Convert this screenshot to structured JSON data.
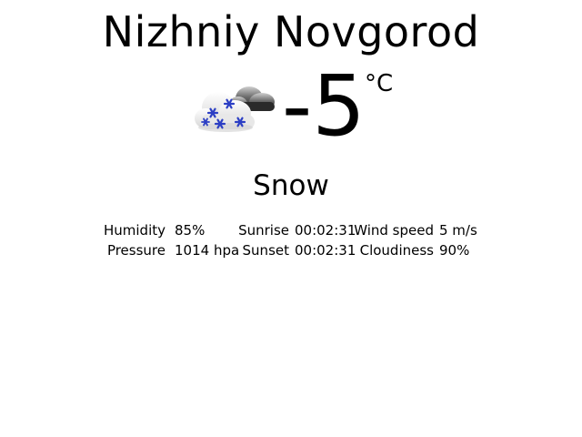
{
  "weather": {
    "city": "Nizhniy Novgorod",
    "temperature": "-5",
    "unit": "°C",
    "condition": "Snow",
    "icon": "snow-cloud-icon",
    "colors": {
      "snowflake": "#2c3fc4",
      "cloud_dark": "#2a2a2a",
      "cloud_light": "#f0f0f0"
    }
  },
  "details": {
    "humidity_label": "Humidity",
    "humidity_value": "85%",
    "pressure_label": "Pressure",
    "pressure_value": "1014 hpa",
    "sunrise_label": "Sunrise",
    "sunrise_value": "00:02:31",
    "sunset_label": "Sunset",
    "sunset_value": "00:02:31",
    "wind_label": "Wind speed",
    "wind_value": "5 m/s",
    "cloudiness_label": "Cloudiness",
    "cloudiness_value": "90%"
  }
}
